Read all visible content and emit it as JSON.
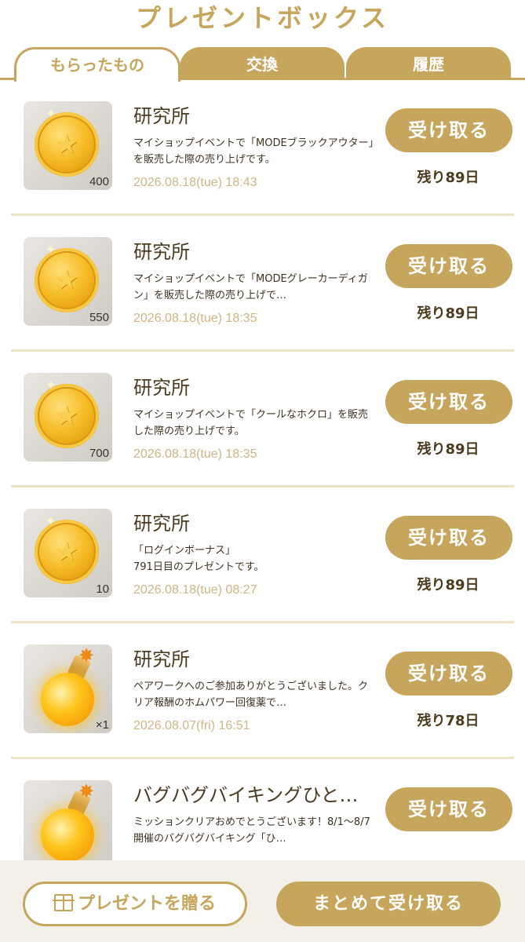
{
  "header": {
    "title": "プレゼントボックス"
  },
  "tabs": [
    {
      "label": "もらったもの",
      "active": true
    },
    {
      "label": "交換",
      "active": false
    },
    {
      "label": "履歴",
      "active": false
    }
  ],
  "items": [
    {
      "icon": "gold-coin-icon",
      "quantity": "400",
      "sender": "研究所",
      "description": "マイショップイベントで「MODEブラックアウター」を販売した際の売り上げです。",
      "date": "2026.08.18(tue) 18:43",
      "action": "受け取る",
      "remaining": "残り89日"
    },
    {
      "icon": "gold-coin-icon",
      "quantity": "550",
      "sender": "研究所",
      "description": "マイショップイベントで「MODEグレーカーディガン」を販売した際の売り上げで…",
      "date": "2026.08.18(tue) 18:35",
      "action": "受け取る",
      "remaining": "残り89日"
    },
    {
      "icon": "gold-coin-icon",
      "quantity": "700",
      "sender": "研究所",
      "description": "マイショップイベントで「クールなホクロ」を販売した際の売り上げです。",
      "date": "2026.08.18(tue) 18:35",
      "action": "受け取る",
      "remaining": "残り89日"
    },
    {
      "icon": "gold-coin-icon",
      "quantity": "10",
      "sender": "研究所",
      "description": "「ログインボーナス」\n791日目のプレゼントです。",
      "date": "2026.08.18(tue) 08:27",
      "action": "受け取る",
      "remaining": "残り89日"
    },
    {
      "icon": "potion-bottle-icon",
      "quantity": "×1",
      "sender": "研究所",
      "description": "ペアワークへのご参加ありがとうございました。クリア報酬のホムパワー回復薬で…",
      "date": "2026.08.07(fri) 16:51",
      "action": "受け取る",
      "remaining": "残り78日"
    },
    {
      "icon": "potion-bottle-icon",
      "quantity": "",
      "sender": "バグバグバイキングひと…",
      "description": "ミッションクリアおめでとうございます！8/1〜8/7開催のバグバグバイキング「ひ…",
      "date": "",
      "action": "受け取る",
      "remaining": ""
    }
  ],
  "footer": {
    "send_gift_label": "プレゼントを贈る",
    "receive_all_label": "まとめて受け取る"
  }
}
